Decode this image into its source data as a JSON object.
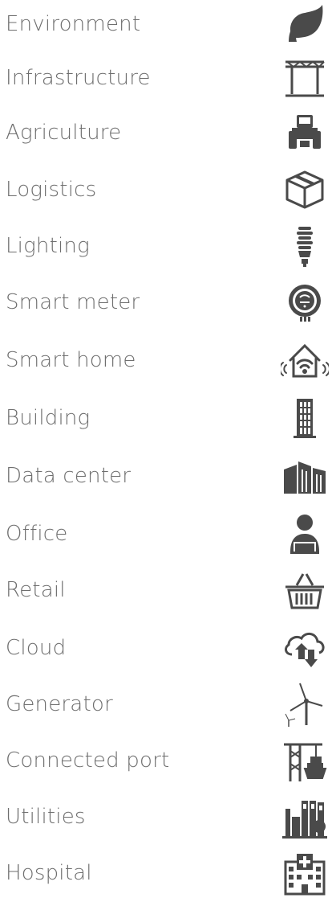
{
  "colors": {
    "text": "#6e6e6e",
    "icon": "#4a4a4a"
  },
  "items": [
    {
      "label": "Environment",
      "icon": "leaf-icon"
    },
    {
      "label": "Infrastructure",
      "icon": "bridge-icon"
    },
    {
      "label": "Agriculture",
      "icon": "tractor-icon"
    },
    {
      "label": "Logistics",
      "icon": "package-icon"
    },
    {
      "label": "Lighting",
      "icon": "light-bulb-icon"
    },
    {
      "label": "Smart meter",
      "icon": "smart-meter-icon"
    },
    {
      "label": "Smart home",
      "icon": "smart-home-icon"
    },
    {
      "label": "Building",
      "icon": "building-icon"
    },
    {
      "label": "Data center",
      "icon": "data-center-icon"
    },
    {
      "label": "Office",
      "icon": "office-worker-icon"
    },
    {
      "label": "Retail",
      "icon": "shopping-basket-icon"
    },
    {
      "label": "Cloud",
      "icon": "cloud-upload-download-icon"
    },
    {
      "label": "Generator",
      "icon": "wind-turbine-icon"
    },
    {
      "label": "Connected port",
      "icon": "port-crane-icon"
    },
    {
      "label": "Utilities",
      "icon": "utilities-plant-icon"
    },
    {
      "label": "Hospital",
      "icon": "hospital-icon"
    }
  ]
}
